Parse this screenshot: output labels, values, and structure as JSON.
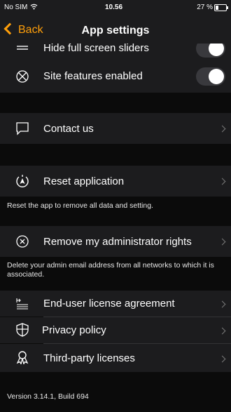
{
  "status": {
    "carrier": "No SIM",
    "time": "10.56",
    "battery": "27 %"
  },
  "nav": {
    "back_label": "Back",
    "title": "App settings"
  },
  "rows": {
    "hide_sliders": {
      "label": "Hide full screen sliders"
    },
    "site_features": {
      "label": "Site features enabled",
      "enabled": false
    },
    "contact": {
      "label": "Contact us"
    },
    "reset": {
      "label": "Reset application",
      "description": "Reset the app to remove all data and setting."
    },
    "remove_admin": {
      "label": "Remove my administrator rights",
      "description": "Delete your admin email address from all networks to which it is associated."
    },
    "eula": {
      "label": "End-user license agreement"
    },
    "privacy": {
      "label": "Privacy policy"
    },
    "third_party": {
      "label": "Third-party licenses"
    }
  },
  "footer": {
    "version": "Version 3.14.1, Build 694"
  }
}
